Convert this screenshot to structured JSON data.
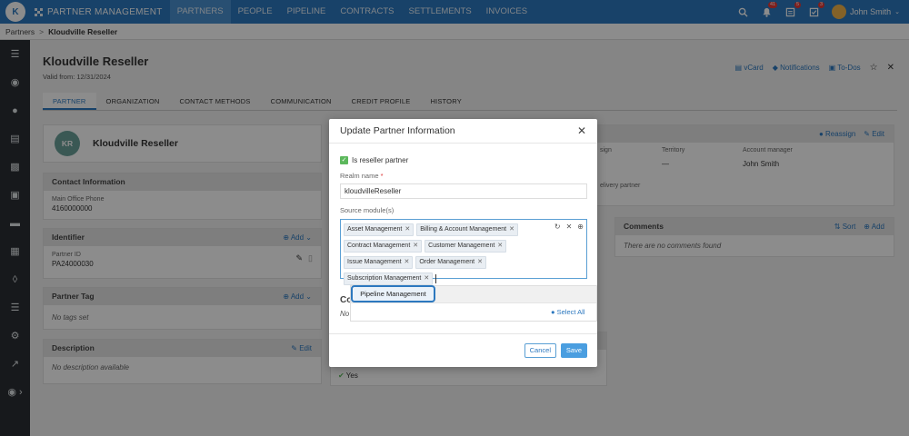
{
  "topbar": {
    "logo": "K",
    "app_title": "PARTNER MANAGEMENT",
    "nav": [
      "PARTNERS",
      "PEOPLE",
      "PIPELINE",
      "CONTRACTS",
      "SETTLEMENTS",
      "INVOICES"
    ],
    "notifications_count": "41",
    "tasks_count": "5",
    "checks_count": "3",
    "user_name": "John Smith"
  },
  "breadcrumb": {
    "root": "Partners",
    "current": "Kloudville Reseller"
  },
  "header": {
    "title": "Kloudville Reseller",
    "valid_label": "Valid from:",
    "valid_date": "12/31/2024",
    "vcard": "vCard",
    "notifications": "Notifications",
    "todos": "To-Dos"
  },
  "tabs": [
    "PARTNER",
    "ORGANIZATION",
    "CONTACT METHODS",
    "COMMUNICATION",
    "CREDIT PROFILE",
    "HISTORY"
  ],
  "left": {
    "initials": "KR",
    "name": "Kloudville Reseller",
    "contact_title": "Contact Information",
    "phone_label": "Main Office Phone",
    "phone": "4160000000",
    "identifier_title": "Identifier",
    "add_label": "Add",
    "partner_id_label": "Partner ID",
    "partner_id": "PA24000030",
    "tag_title": "Partner Tag",
    "no_tags": "No tags set",
    "description_title": "Description",
    "edit_label": "Edit",
    "no_description": "No description available"
  },
  "right": {
    "reassign": "Reassign",
    "edit": "Edit",
    "assign_partial": "sign",
    "territory_label": "Territory",
    "territory": "—",
    "account_manager_label": "Account manager",
    "account_manager": "John Smith",
    "delivery_partial": "elivery partner",
    "comments_title": "Comments",
    "sort": "Sort",
    "add": "Add",
    "no_comments": "There are no comments found",
    "yes": "Yes"
  },
  "modal": {
    "title": "Update Partner Information",
    "reseller_label": "Is reseller partner",
    "realm_label": "Realm name",
    "realm_value": "kloudvilleReseller",
    "source_label": "Source module(s)",
    "chips": [
      "Asset Management",
      "Billing & Account Management",
      "Contract Management",
      "Customer Management",
      "Issue Management",
      "Order Management",
      "Subscription Management"
    ],
    "dropdown_option": "Pipeline Management",
    "select_all": "Select All",
    "behind_co": "Co",
    "behind_no": "No",
    "cancel": "Cancel",
    "save": "Save"
  },
  "colors": {
    "brand": "#2c78bf",
    "sidebar": "#2b2f33",
    "success": "#5cb85c"
  }
}
